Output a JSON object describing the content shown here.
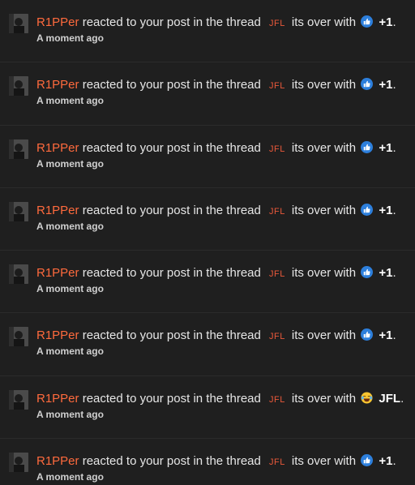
{
  "colors": {
    "background": "#1f1f1f",
    "username": "#ff6a3d",
    "thread_tag": "#e8583a",
    "text": "#e6e6e6"
  },
  "notifications": [
    {
      "user": "R1PPer",
      "text": "reacted to your post in the thread",
      "tag": "JFL",
      "title": "its over",
      "with": "with",
      "reaction_icon": "like-icon",
      "reaction": "+1",
      "end": ".",
      "time": "A moment ago"
    },
    {
      "user": "R1PPer",
      "text": "reacted to your post in the thread",
      "tag": "JFL",
      "title": "its over",
      "with": "with",
      "reaction_icon": "like-icon",
      "reaction": "+1",
      "end": ".",
      "time": "A moment ago"
    },
    {
      "user": "R1PPer",
      "text": "reacted to your post in the thread",
      "tag": "JFL",
      "title": "its over",
      "with": "with",
      "reaction_icon": "like-icon",
      "reaction": "+1",
      "end": ".",
      "time": "A moment ago"
    },
    {
      "user": "R1PPer",
      "text": "reacted to your post in the thread",
      "tag": "JFL",
      "title": "its over",
      "with": "with",
      "reaction_icon": "like-icon",
      "reaction": "+1",
      "end": ".",
      "time": "A moment ago"
    },
    {
      "user": "R1PPer",
      "text": "reacted to your post in the thread",
      "tag": "JFL",
      "title": "its over",
      "with": "with",
      "reaction_icon": "like-icon",
      "reaction": "+1",
      "end": ".",
      "time": "A moment ago"
    },
    {
      "user": "R1PPer",
      "text": "reacted to your post in the thread",
      "tag": "JFL",
      "title": "its over",
      "with": "with",
      "reaction_icon": "like-icon",
      "reaction": "+1",
      "end": ".",
      "time": "A moment ago"
    },
    {
      "user": "R1PPer",
      "text": "reacted to your post in the thread",
      "tag": "JFL",
      "title": "its over",
      "with": "with",
      "reaction_icon": "laughing-crying-emoji-icon",
      "reaction": "JFL",
      "end": ".",
      "time": "A moment ago"
    },
    {
      "user": "R1PPer",
      "text": "reacted to your post in the thread",
      "tag": "JFL",
      "title": "its over",
      "with": "with",
      "reaction_icon": "like-icon",
      "reaction": "+1",
      "end": ".",
      "time": "A moment ago"
    }
  ]
}
